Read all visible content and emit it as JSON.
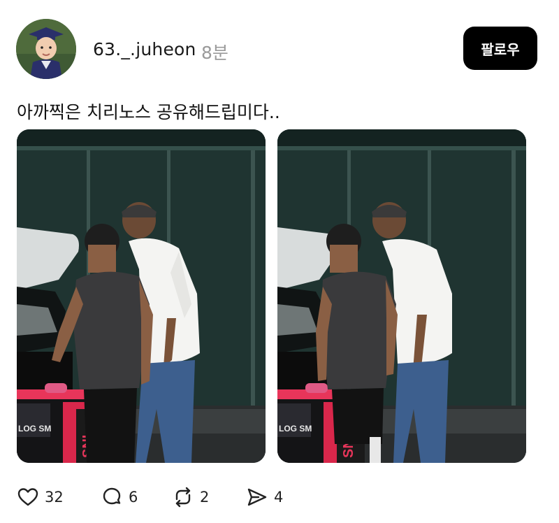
{
  "post": {
    "username": "63._.juheon",
    "time": "8분",
    "follow_label": "팔로우",
    "caption": "아까찍은 치리노스 공유해드립미다..",
    "photo_1_text": "SNI",
    "photo_2_text": "SNI",
    "bag_text_1": "LOG SM",
    "bag_text_2": "LOG SM"
  },
  "actions": {
    "likes": "32",
    "replies": "6",
    "reposts": "2",
    "shares": "4"
  },
  "icons": {
    "like": "heart-icon",
    "reply": "comment-icon",
    "repost": "repost-icon",
    "share": "send-icon"
  },
  "colors": {
    "follow_bg": "#000000",
    "follow_text": "#ffffff",
    "timestamp": "#9a9a9a"
  }
}
